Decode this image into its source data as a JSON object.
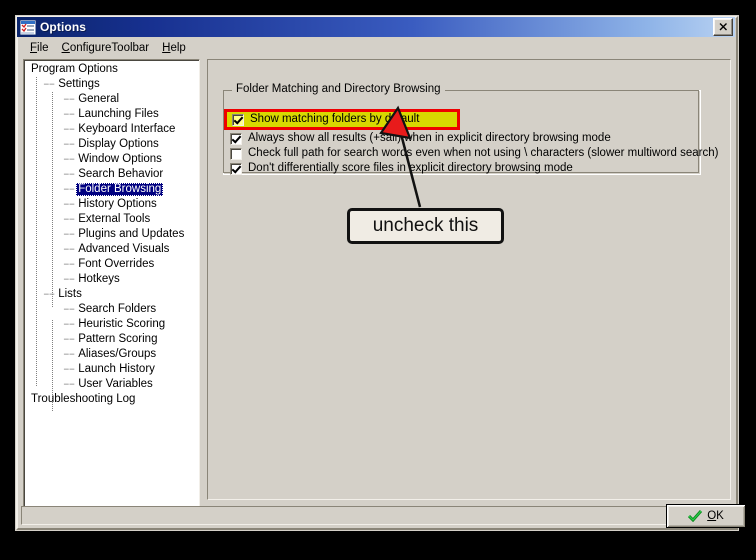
{
  "window": {
    "title": "Options",
    "icon": "options-window-icon",
    "close_label": "✕"
  },
  "menubar": {
    "items": [
      {
        "label": "File",
        "accel": "F",
        "rest": "ile"
      },
      {
        "label": "ConfigureToolbar",
        "accel": "C",
        "rest": "onfigureToolbar"
      },
      {
        "label": "Help",
        "accel": "H",
        "rest": "elp"
      }
    ]
  },
  "tree": {
    "items": [
      {
        "label": "Program Options",
        "level": 0,
        "selected": false,
        "dash": false
      },
      {
        "label": "Settings",
        "level": 1,
        "selected": false,
        "dash": true
      },
      {
        "label": "General",
        "level": 2,
        "selected": false,
        "dash": true
      },
      {
        "label": "Launching Files",
        "level": 2,
        "selected": false,
        "dash": true
      },
      {
        "label": "Keyboard Interface",
        "level": 2,
        "selected": false,
        "dash": true
      },
      {
        "label": "Display Options",
        "level": 2,
        "selected": false,
        "dash": true
      },
      {
        "label": "Window Options",
        "level": 2,
        "selected": false,
        "dash": true
      },
      {
        "label": "Search Behavior",
        "level": 2,
        "selected": false,
        "dash": true
      },
      {
        "label": "Folder Browsing",
        "level": 2,
        "selected": true,
        "dash": true
      },
      {
        "label": "History Options",
        "level": 2,
        "selected": false,
        "dash": true
      },
      {
        "label": "External Tools",
        "level": 2,
        "selected": false,
        "dash": true
      },
      {
        "label": "Plugins and Updates",
        "level": 2,
        "selected": false,
        "dash": true
      },
      {
        "label": "Advanced Visuals",
        "level": 2,
        "selected": false,
        "dash": true
      },
      {
        "label": "Font Overrides",
        "level": 2,
        "selected": false,
        "dash": true
      },
      {
        "label": "Hotkeys",
        "level": 2,
        "selected": false,
        "dash": true
      },
      {
        "label": "Lists",
        "level": 1,
        "selected": false,
        "dash": true
      },
      {
        "label": "Search Folders",
        "level": 2,
        "selected": false,
        "dash": true
      },
      {
        "label": "Heuristic Scoring",
        "level": 2,
        "selected": false,
        "dash": true
      },
      {
        "label": "Pattern Scoring",
        "level": 2,
        "selected": false,
        "dash": true
      },
      {
        "label": "Aliases/Groups",
        "level": 2,
        "selected": false,
        "dash": true
      },
      {
        "label": "Launch History",
        "level": 2,
        "selected": false,
        "dash": true
      },
      {
        "label": "User Variables",
        "level": 2,
        "selected": false,
        "dash": true
      },
      {
        "label": "Troubleshooting Log",
        "level": 0,
        "selected": false,
        "dash": false
      }
    ]
  },
  "groupbox": {
    "title": "Folder Matching and Directory Browsing",
    "checkboxes": [
      {
        "label": "Show matching folders by default",
        "checked": true,
        "highlighted": true
      },
      {
        "label": "Always show all results (+sall) when in explicit directory browsing mode",
        "checked": true,
        "highlighted": false
      },
      {
        "label": "Check full path for search words even when not using \\ characters (slower multiword search)",
        "checked": false,
        "highlighted": false
      },
      {
        "label": "Don't differentially score files in explicit directory browsing mode",
        "checked": true,
        "highlighted": false
      }
    ]
  },
  "annotation": {
    "callout_text": "uncheck this",
    "arrow_color": "#e81b1b",
    "highlight_fill": "#d8d800",
    "highlight_border": "#ee0000"
  },
  "buttons": {
    "ok": {
      "label": "OK",
      "accel": "O",
      "rest": "K",
      "icon": "green-check-icon"
    }
  },
  "statusbar": {
    "text": "",
    "grip": "resize-grip"
  },
  "colors": {
    "title_start": "#0a246a",
    "title_end": "#b9d2f2",
    "face": "#d4d0c8",
    "selection": "#000080"
  }
}
